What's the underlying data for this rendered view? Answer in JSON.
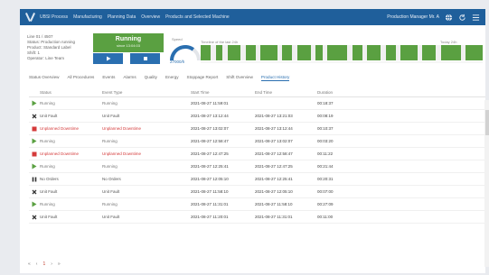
{
  "colors": {
    "header": "#1f5f9b",
    "running": "#5aa041",
    "stopped": "#d43a3a",
    "idle": "#9aa0a6",
    "accent": "#2a6fb0"
  },
  "header": {
    "logo_icon": "logo-icon",
    "title": "UBSI Process",
    "nav": [
      "Manufacturing",
      "Planning Data",
      "Overview",
      "Products and Selected Machine"
    ],
    "user": "Production Manager Mr. A",
    "user_icon": "globe-icon",
    "refresh_icon": "refresh-icon",
    "menu_icon": "hamburger-icon"
  },
  "summary": {
    "lines": [
      "Line 01 / 4507",
      "Status: Production running",
      "Product: Standard Label",
      "Shift: 1",
      "Operator: Line Team"
    ]
  },
  "status": {
    "label": "Running",
    "sub": "since 13:04:03",
    "button_left_icon": "play-icon",
    "button_right_icon": "stop-icon"
  },
  "gauge": {
    "label": "Speed",
    "value": "27000/h",
    "fraction": 0.7
  },
  "timeline": {
    "label": "Timeline of the last 24h",
    "range": "Today 24h",
    "segments": [
      {
        "w": 3,
        "c": "#5aa041"
      },
      {
        "w": 1.5,
        "c": "#f0f0f0"
      },
      {
        "w": 2,
        "c": "#5aa041"
      },
      {
        "w": 1.5,
        "c": "#f0f0f0"
      },
      {
        "w": 4,
        "c": "#5aa041"
      },
      {
        "w": 1.5,
        "c": "#f0f0f0"
      },
      {
        "w": 3,
        "c": "#5aa041"
      },
      {
        "w": 1.5,
        "c": "#f0f0f0"
      },
      {
        "w": 5,
        "c": "#5aa041"
      },
      {
        "w": 1.5,
        "c": "#f0f0f0"
      },
      {
        "w": 3,
        "c": "#5aa041"
      },
      {
        "w": 1.5,
        "c": "#f0f0f0"
      },
      {
        "w": 4,
        "c": "#5aa041"
      },
      {
        "w": 1.5,
        "c": "#f0f0f0"
      },
      {
        "w": 2,
        "c": "#5aa041"
      },
      {
        "w": 1.5,
        "c": "#f0f0f0"
      },
      {
        "w": 6,
        "c": "#5aa041"
      },
      {
        "w": 1.5,
        "c": "#f0f0f0"
      },
      {
        "w": 3,
        "c": "#5aa041"
      },
      {
        "w": 1.5,
        "c": "#f0f0f0"
      },
      {
        "w": 4,
        "c": "#5aa041"
      },
      {
        "w": 1.5,
        "c": "#f0f0f0"
      },
      {
        "w": 3,
        "c": "#5aa041"
      },
      {
        "w": 1.5,
        "c": "#f0f0f0"
      },
      {
        "w": 5,
        "c": "#5aa041"
      },
      {
        "w": 1.5,
        "c": "#f0f0f0"
      },
      {
        "w": 4,
        "c": "#5aa041"
      },
      {
        "w": 1.5,
        "c": "#f0f0f0"
      },
      {
        "w": 6,
        "c": "#5aa041"
      },
      {
        "w": 1.5,
        "c": "#f0f0f0"
      },
      {
        "w": 5,
        "c": "#5aa041"
      }
    ]
  },
  "tabs": [
    "Status Overview",
    "All Procedures",
    "Events",
    "Alarms",
    "Quality",
    "Energy",
    "Stoppage Report",
    "Shift Overview",
    "Product History"
  ],
  "active_tab": 8,
  "table": {
    "columns": [
      "Status",
      "Event Type",
      "Start Time",
      "End Time",
      "Duration"
    ],
    "rows": [
      {
        "icon": "play-icon",
        "icon_color": "#5aa041",
        "status": "Running",
        "status_color": "#777",
        "type": "Running",
        "start": "2021-08-27 11:59:01",
        "end": "",
        "dur": "00:18:37"
      },
      {
        "icon": "x-icon",
        "icon_color": "#333",
        "status": "Unit Fault",
        "status_color": "#555",
        "type": "Unit Fault",
        "start": "2021-08-27 13:12:44",
        "end": "2021-08-27 13:21:03",
        "dur": "00:08:19"
      },
      {
        "icon": "square-icon",
        "icon_color": "#d43a3a",
        "status": "Unplanned Downtime",
        "status_color": "#d43a3a",
        "type": "Unplanned Downtime",
        "start": "2021-08-27 13:02:07",
        "end": "2021-08-27 13:12:44",
        "dur": "00:10:37"
      },
      {
        "icon": "play-icon",
        "icon_color": "#5aa041",
        "status": "Running",
        "status_color": "#777",
        "type": "Running",
        "start": "2021-08-27 12:58:47",
        "end": "2021-08-27 13:02:07",
        "dur": "00:03:20"
      },
      {
        "icon": "square-icon",
        "icon_color": "#d43a3a",
        "status": "Unplanned Downtime",
        "status_color": "#d43a3a",
        "type": "Unplanned Downtime",
        "start": "2021-08-27 12:47:25",
        "end": "2021-08-27 12:58:47",
        "dur": "00:11:22"
      },
      {
        "icon": "play-icon",
        "icon_color": "#5aa041",
        "status": "Running",
        "status_color": "#777",
        "type": "Running",
        "start": "2021-08-27 12:25:41",
        "end": "2021-08-27 12:47:25",
        "dur": "00:21:44"
      },
      {
        "icon": "pause-icon",
        "icon_color": "#333",
        "status": "No Orders",
        "status_color": "#555",
        "type": "No Orders",
        "start": "2021-08-27 12:05:10",
        "end": "2021-08-27 12:25:41",
        "dur": "00:20:31"
      },
      {
        "icon": "x-icon",
        "icon_color": "#333",
        "status": "Unit Fault",
        "status_color": "#555",
        "type": "Unit Fault",
        "start": "2021-08-27 11:58:10",
        "end": "2021-08-27 12:05:10",
        "dur": "00:07:00"
      },
      {
        "icon": "play-icon",
        "icon_color": "#5aa041",
        "status": "Running",
        "status_color": "#777",
        "type": "Running",
        "start": "2021-08-27 11:31:01",
        "end": "2021-08-27 11:58:10",
        "dur": "00:27:09"
      },
      {
        "icon": "x-icon",
        "icon_color": "#333",
        "status": "Unit Fault",
        "status_color": "#555",
        "type": "Unit Fault",
        "start": "2021-08-27 11:20:01",
        "end": "2021-08-27 11:31:01",
        "dur": "00:11:00"
      }
    ]
  },
  "pager": {
    "first": "«",
    "prev": "‹",
    "page": "1",
    "next": "›",
    "last": "»"
  }
}
